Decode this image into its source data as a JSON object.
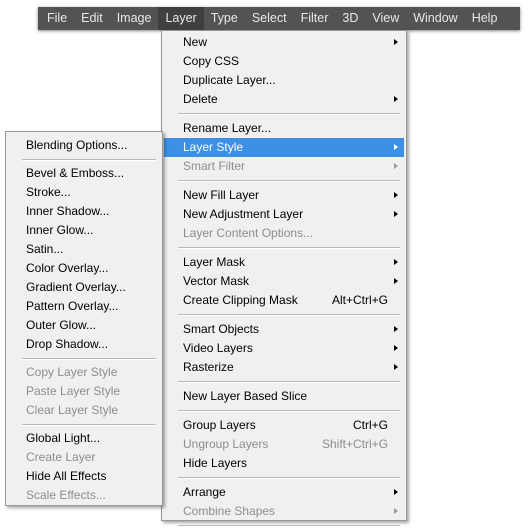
{
  "menubar": {
    "items": [
      "File",
      "Edit",
      "Image",
      "Layer",
      "Type",
      "Select",
      "Filter",
      "3D",
      "View",
      "Window",
      "Help"
    ],
    "active": "Layer"
  },
  "colors": {
    "menubar_bg": "#535353",
    "highlight": "#3c91e6",
    "disabled_text": "#8d8d8d",
    "menu_bg": "#f0f0f0"
  },
  "layer_menu": [
    {
      "label": "New",
      "submenu": true
    },
    {
      "label": "Copy CSS"
    },
    {
      "label": "Duplicate Layer..."
    },
    {
      "label": "Delete",
      "submenu": true
    },
    {
      "separator": true
    },
    {
      "label": "Rename Layer..."
    },
    {
      "label": "Layer Style",
      "submenu": true,
      "highlighted": true
    },
    {
      "label": "Smart Filter",
      "submenu": true,
      "disabled": true
    },
    {
      "separator": true
    },
    {
      "label": "New Fill Layer",
      "submenu": true
    },
    {
      "label": "New Adjustment Layer",
      "submenu": true
    },
    {
      "label": "Layer Content Options...",
      "disabled": true
    },
    {
      "separator": true
    },
    {
      "label": "Layer Mask",
      "submenu": true
    },
    {
      "label": "Vector Mask",
      "submenu": true
    },
    {
      "label": "Create Clipping Mask",
      "shortcut": "Alt+Ctrl+G"
    },
    {
      "separator": true
    },
    {
      "label": "Smart Objects",
      "submenu": true
    },
    {
      "label": "Video Layers",
      "submenu": true
    },
    {
      "label": "Rasterize",
      "submenu": true
    },
    {
      "separator": true
    },
    {
      "label": "New Layer Based Slice"
    },
    {
      "separator": true
    },
    {
      "label": "Group Layers",
      "shortcut": "Ctrl+G"
    },
    {
      "label": "Ungroup Layers",
      "shortcut": "Shift+Ctrl+G",
      "disabled": true
    },
    {
      "label": "Hide Layers"
    },
    {
      "separator": true
    },
    {
      "label": "Arrange",
      "submenu": true
    },
    {
      "label": "Combine Shapes",
      "submenu": true,
      "disabled": true
    },
    {
      "separator": true
    }
  ],
  "layer_style_menu": [
    {
      "label": "Blending Options..."
    },
    {
      "separator": true
    },
    {
      "label": "Bevel & Emboss..."
    },
    {
      "label": "Stroke..."
    },
    {
      "label": "Inner Shadow..."
    },
    {
      "label": "Inner Glow..."
    },
    {
      "label": "Satin..."
    },
    {
      "label": "Color Overlay..."
    },
    {
      "label": "Gradient Overlay..."
    },
    {
      "label": "Pattern Overlay..."
    },
    {
      "label": "Outer Glow..."
    },
    {
      "label": "Drop Shadow..."
    },
    {
      "separator": true
    },
    {
      "label": "Copy Layer Style",
      "disabled": true
    },
    {
      "label": "Paste Layer Style",
      "disabled": true
    },
    {
      "label": "Clear Layer Style",
      "disabled": true
    },
    {
      "separator": true
    },
    {
      "label": "Global Light..."
    },
    {
      "label": "Create Layer",
      "disabled": true
    },
    {
      "label": "Hide All Effects"
    },
    {
      "label": "Scale Effects...",
      "disabled": true
    }
  ]
}
